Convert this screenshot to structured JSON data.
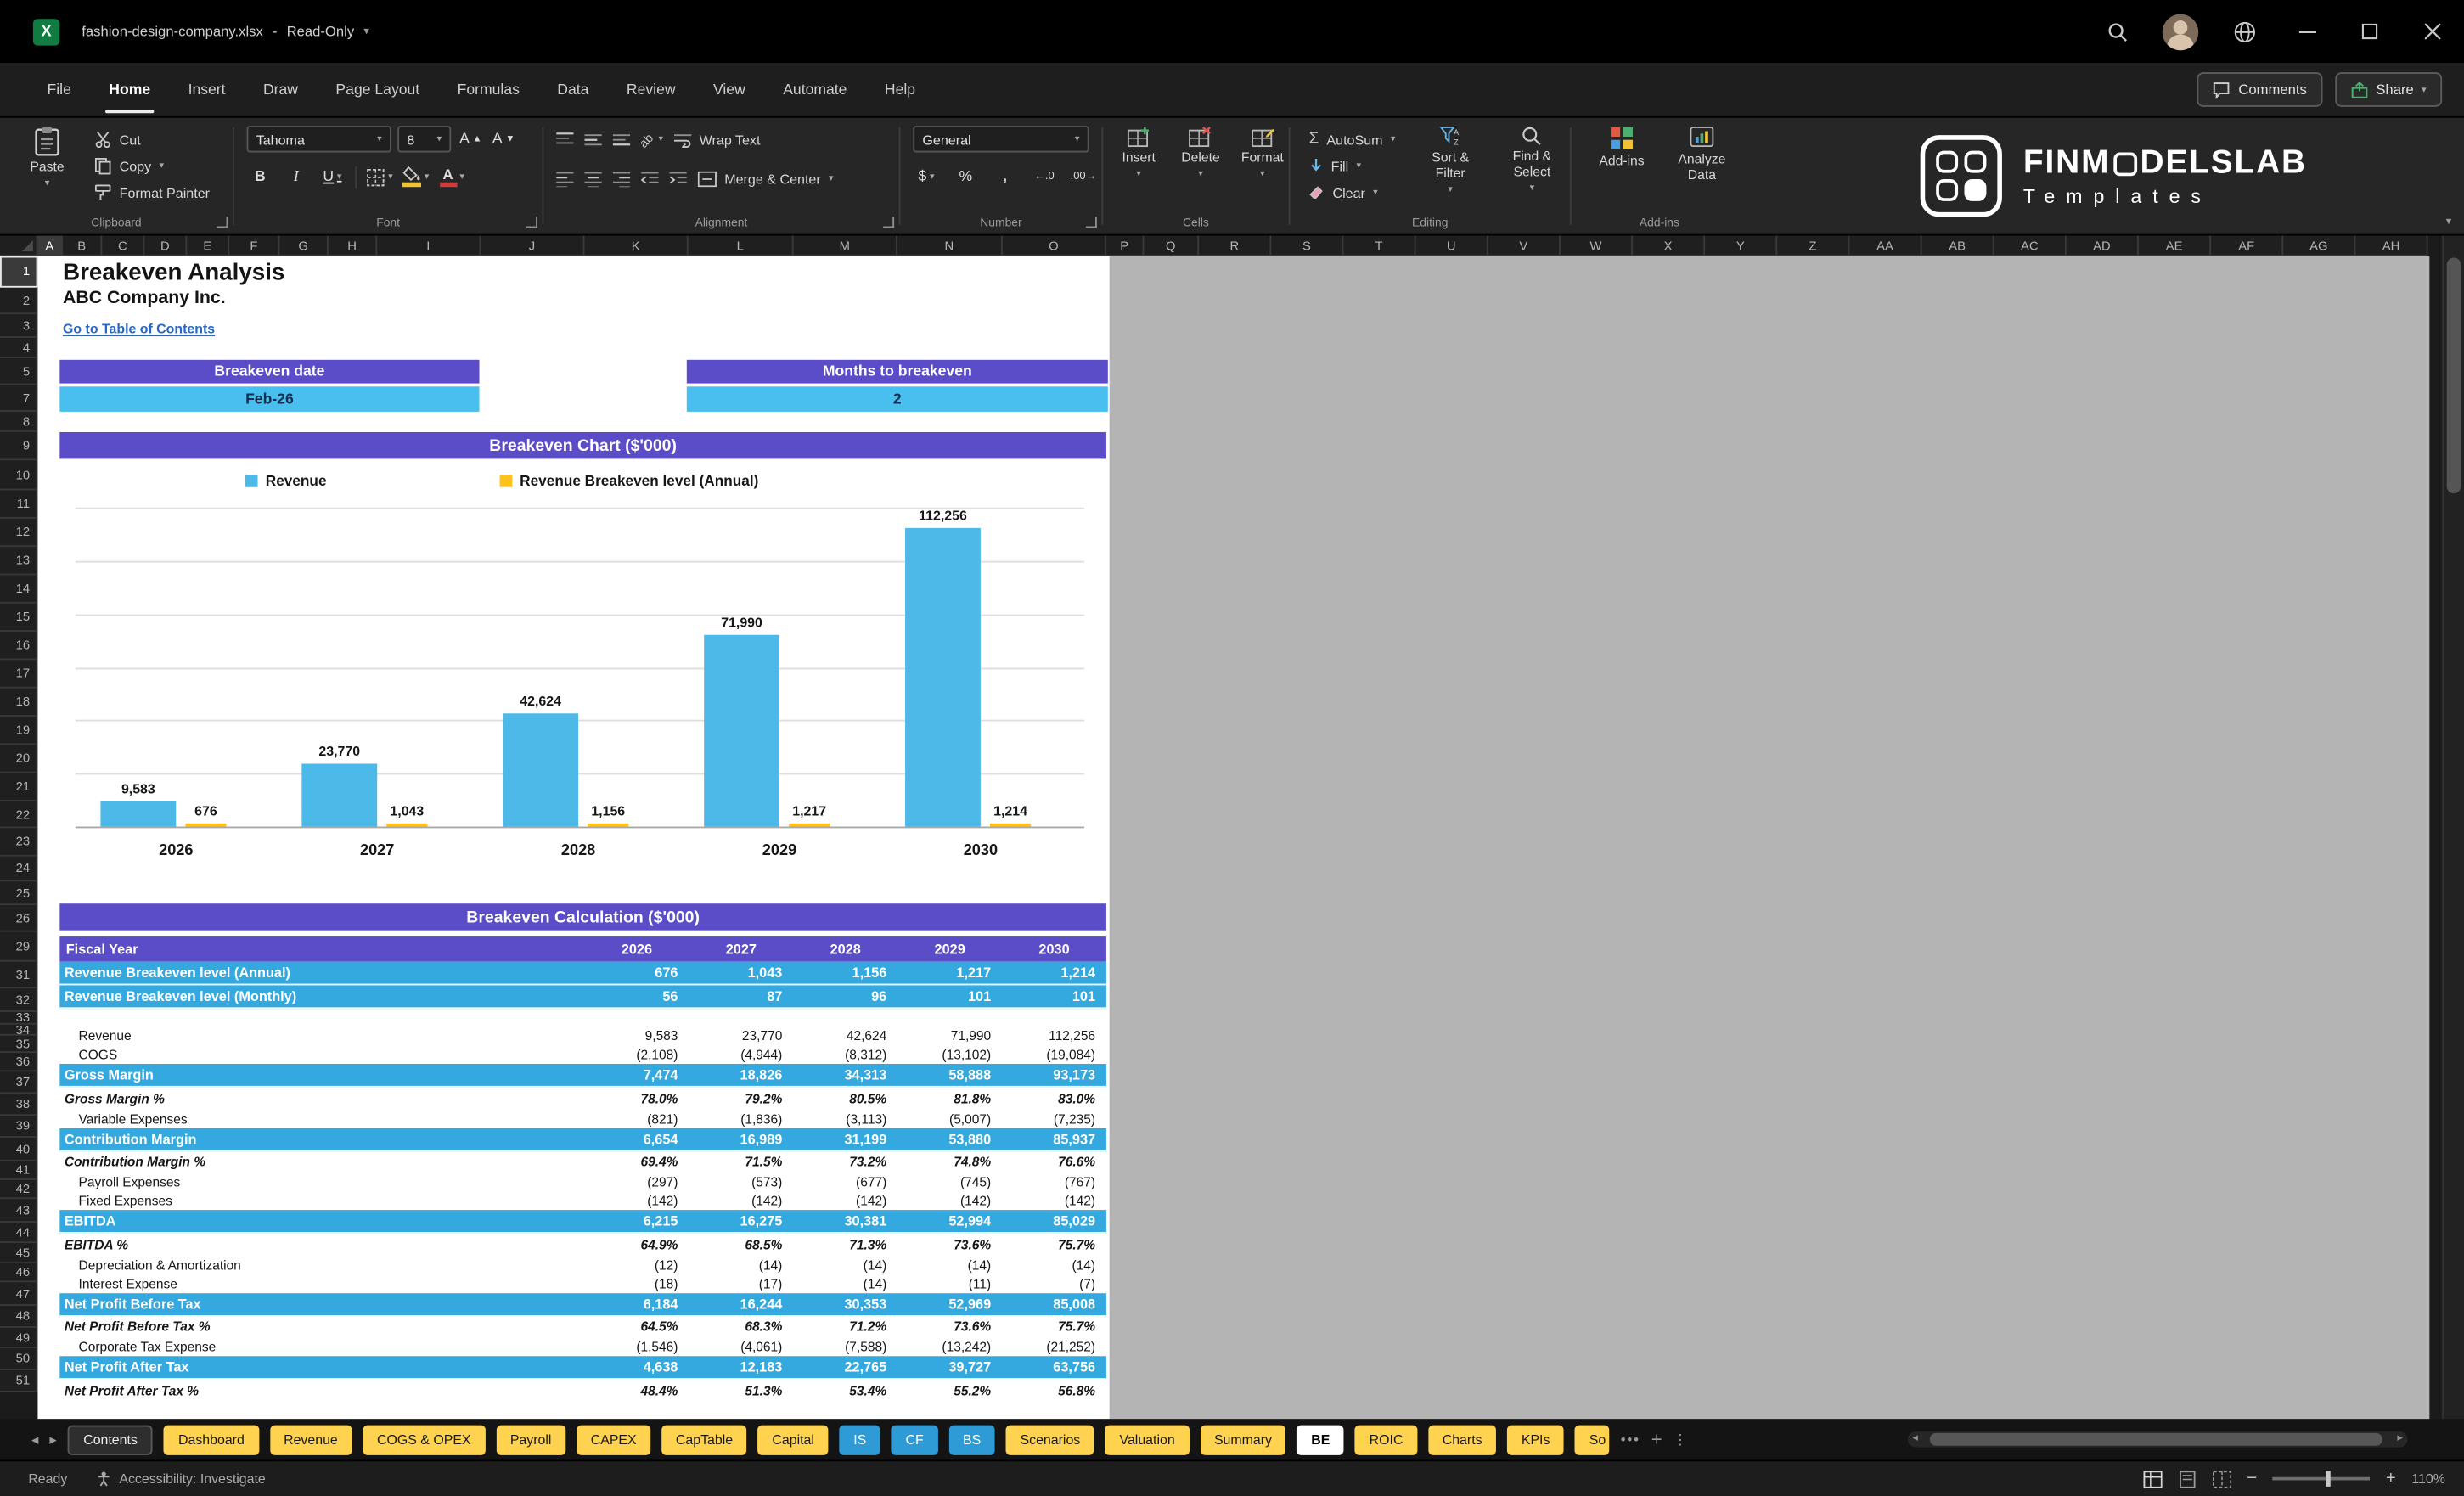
{
  "titlebar": {
    "filename": "fashion-design-company.xlsx",
    "separator": "-",
    "mode": "Read-Only"
  },
  "ribbon": {
    "tabs": [
      "File",
      "Home",
      "Insert",
      "Draw",
      "Page Layout",
      "Formulas",
      "Data",
      "Review",
      "View",
      "Automate",
      "Help"
    ],
    "active_tab": "Home",
    "comments_label": "Comments",
    "share_label": "Share",
    "groups": {
      "clipboard": {
        "label": "Clipboard",
        "paste": "Paste",
        "cut": "Cut",
        "copy": "Copy",
        "format_painter": "Format Painter"
      },
      "font": {
        "label": "Font",
        "family": "Tahoma",
        "size": "8"
      },
      "alignment": {
        "label": "Alignment",
        "wrap_text": "Wrap Text",
        "merge_center": "Merge & Center"
      },
      "number": {
        "label": "Number",
        "format": "General"
      },
      "cells": {
        "label": "Cells",
        "insert": "Insert",
        "delete": "Delete",
        "format": "Format"
      },
      "editing": {
        "label": "Editing",
        "autosum": "AutoSum",
        "fill": "Fill",
        "clear": "Clear",
        "sort_filter": "Sort & Filter",
        "find_select": "Find & Select"
      },
      "addins": {
        "label": "Add-ins",
        "addins": "Add-ins",
        "analyze": "Analyze Data"
      }
    },
    "logo": {
      "prefix": "FINM",
      "suffix": "DELSLAB",
      "line2": "Templates"
    }
  },
  "grid": {
    "columns": [
      "A",
      "B",
      "C",
      "D",
      "E",
      "F",
      "G",
      "H",
      "I",
      "J",
      "K",
      "L",
      "M",
      "N",
      "O",
      "P",
      "Q",
      "R",
      "S",
      "T",
      "U",
      "V",
      "W",
      "X",
      "Y",
      "Z",
      "AA",
      "AB",
      "AC",
      "AD",
      "AE",
      "AF",
      "AG",
      "AH"
    ],
    "rows": [
      "1",
      "2",
      "3",
      "4",
      "5",
      "7",
      "8",
      "9",
      "10",
      "11",
      "12",
      "13",
      "14",
      "15",
      "16",
      "17",
      "18",
      "19",
      "20",
      "21",
      "22",
      "23",
      "24",
      "25",
      "26",
      "29",
      "31",
      "32",
      "33",
      "34",
      "35",
      "36",
      "37",
      "38",
      "39",
      "40",
      "41",
      "42",
      "43",
      "44",
      "45",
      "46",
      "47",
      "48",
      "49",
      "50",
      "51"
    ]
  },
  "sheet": {
    "title": "Breakeven Analysis",
    "company": "ABC Company Inc.",
    "toc_link": "Go to Table of Contents",
    "breakeven_date": {
      "label": "Breakeven date",
      "value": "Feb-26"
    },
    "months_to_breakeven": {
      "label": "Months to breakeven",
      "value": "2"
    },
    "chart_header": "Breakeven Chart ($'000)",
    "calc_header": "Breakeven Calculation ($'000)"
  },
  "chart_data": {
    "type": "bar",
    "title": "Breakeven Chart ($'000)",
    "categories": [
      "2026",
      "2027",
      "2028",
      "2029",
      "2030"
    ],
    "series": [
      {
        "name": "Revenue",
        "color": "#4cb9e9",
        "values": [
          9583,
          23770,
          42624,
          71990,
          112256
        ],
        "labels": [
          "9,583",
          "23,770",
          "42,624",
          "71,990",
          "112,256"
        ]
      },
      {
        "name": "Revenue Breakeven level (Annual)",
        "color": "#ffc21d",
        "values": [
          676,
          1043,
          1156,
          1217,
          1214
        ],
        "labels": [
          "676",
          "1,043",
          "1,156",
          "1,217",
          "1,214"
        ]
      }
    ],
    "ylim": [
      0,
      120000
    ],
    "gridline_step": 20000,
    "grid": true,
    "y_tick_labels_visible": false,
    "legend_position": "top"
  },
  "table": {
    "header": [
      "Fiscal Year",
      "2026",
      "2027",
      "2028",
      "2029",
      "2030"
    ],
    "rows": [
      {
        "label": "Revenue Breakeven level (Annual)",
        "style": "blue",
        "values": [
          "676",
          "1,043",
          "1,156",
          "1,217",
          "1,214"
        ]
      },
      {
        "label": "Revenue Breakeven level (Monthly)",
        "style": "blue",
        "values": [
          "56",
          "87",
          "96",
          "101",
          "101"
        ]
      },
      {
        "label": "",
        "style": "spacer",
        "values": [
          "",
          "",
          "",
          "",
          ""
        ]
      },
      {
        "label": "Revenue",
        "style": "plain",
        "values": [
          "9,583",
          "23,770",
          "42,624",
          "71,990",
          "112,256"
        ]
      },
      {
        "label": "COGS",
        "style": "plain",
        "values": [
          "(2,108)",
          "(4,944)",
          "(8,312)",
          "(13,102)",
          "(19,084)"
        ]
      },
      {
        "label": "Gross Margin",
        "style": "blue",
        "values": [
          "7,474",
          "18,826",
          "34,313",
          "58,888",
          "93,173"
        ]
      },
      {
        "label": "Gross Margin %",
        "style": "pct",
        "values": [
          "78.0%",
          "79.2%",
          "80.5%",
          "81.8%",
          "83.0%"
        ]
      },
      {
        "label": "Variable Expenses",
        "style": "plain",
        "values": [
          "(821)",
          "(1,836)",
          "(3,113)",
          "(5,007)",
          "(7,235)"
        ]
      },
      {
        "label": "Contribution Margin",
        "style": "blue",
        "values": [
          "6,654",
          "16,989",
          "31,199",
          "53,880",
          "85,937"
        ]
      },
      {
        "label": "Contribution Margin %",
        "style": "pct",
        "values": [
          "69.4%",
          "71.5%",
          "73.2%",
          "74.8%",
          "76.6%"
        ]
      },
      {
        "label": "Payroll Expenses",
        "style": "plain",
        "values": [
          "(297)",
          "(573)",
          "(677)",
          "(745)",
          "(767)"
        ]
      },
      {
        "label": "Fixed Expenses",
        "style": "plain",
        "values": [
          "(142)",
          "(142)",
          "(142)",
          "(142)",
          "(142)"
        ]
      },
      {
        "label": "EBITDA",
        "style": "blue",
        "values": [
          "6,215",
          "16,275",
          "30,381",
          "52,994",
          "85,029"
        ]
      },
      {
        "label": "EBITDA %",
        "style": "pct",
        "values": [
          "64.9%",
          "68.5%",
          "71.3%",
          "73.6%",
          "75.7%"
        ]
      },
      {
        "label": "Depreciation & Amortization",
        "style": "plain",
        "values": [
          "(12)",
          "(14)",
          "(14)",
          "(14)",
          "(14)"
        ]
      },
      {
        "label": "Interest Expense",
        "style": "plain",
        "values": [
          "(18)",
          "(17)",
          "(14)",
          "(11)",
          "(7)"
        ]
      },
      {
        "label": "Net Profit Before Tax",
        "style": "blue",
        "values": [
          "6,184",
          "16,244",
          "30,353",
          "52,969",
          "85,008"
        ]
      },
      {
        "label": "Net Profit Before Tax %",
        "style": "pct",
        "values": [
          "64.5%",
          "68.3%",
          "71.2%",
          "73.6%",
          "75.7%"
        ]
      },
      {
        "label": "Corporate Tax Expense",
        "style": "plain",
        "values": [
          "(1,546)",
          "(4,061)",
          "(7,588)",
          "(13,242)",
          "(21,252)"
        ]
      },
      {
        "label": "Net Profit After Tax",
        "style": "blue",
        "values": [
          "4,638",
          "12,183",
          "22,765",
          "39,727",
          "63,756"
        ]
      },
      {
        "label": "Net Profit After Tax %",
        "style": "pct",
        "values": [
          "48.4%",
          "51.3%",
          "53.4%",
          "55.2%",
          "56.8%"
        ]
      }
    ]
  },
  "sheet_tabs": {
    "items": [
      {
        "label": "Contents",
        "style": "dark"
      },
      {
        "label": "Dashboard",
        "style": "yellow"
      },
      {
        "label": "Revenue",
        "style": "yellow"
      },
      {
        "label": "COGS & OPEX",
        "style": "yellow"
      },
      {
        "label": "Payroll",
        "style": "yellow"
      },
      {
        "label": "CAPEX",
        "style": "yellow"
      },
      {
        "label": "CapTable",
        "style": "yellow"
      },
      {
        "label": "Capital",
        "style": "yellow"
      },
      {
        "label": "IS",
        "style": "blue"
      },
      {
        "label": "CF",
        "style": "blue"
      },
      {
        "label": "BS",
        "style": "blue"
      },
      {
        "label": "Scenarios",
        "style": "yellow"
      },
      {
        "label": "Valuation",
        "style": "yellow"
      },
      {
        "label": "Summary",
        "style": "yellow"
      },
      {
        "label": "BE",
        "style": "active"
      },
      {
        "label": "ROIC",
        "style": "yellow"
      },
      {
        "label": "Charts",
        "style": "yellow"
      },
      {
        "label": "KPIs",
        "style": "yellow"
      },
      {
        "label": "So",
        "style": "yellow clip"
      }
    ]
  },
  "statusbar": {
    "ready": "Ready",
    "accessibility": "Accessibility: Investigate",
    "zoom": "110%"
  }
}
